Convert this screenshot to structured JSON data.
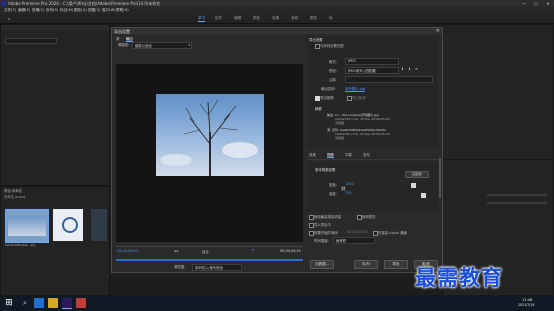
{
  "window": {
    "title": "Adobe Premiere Pro 2020 - C:\\用户\\Ifmy\\文档\\Adobe\\Premiere Pro\\14.0\\未命名",
    "controls": [
      "—",
      "☐",
      "✕"
    ]
  },
  "menubar": [
    "文件(F)",
    "编辑(E)",
    "剪辑(C)",
    "序列(S)",
    "标记(M)",
    "图形(G)",
    "视图(V)",
    "窗口(W)",
    "帮助(H)"
  ],
  "workspaces": {
    "items": [
      "学习",
      "组件",
      "编辑",
      "颜色",
      "效果",
      "音频",
      "图形",
      "库"
    ],
    "active_index": 0
  },
  "project_panel": {
    "title": "项目:未命名",
    "file_label": "未命名.prproj",
    "thumb_label": "5e0af7b8f5ab4e...jpg"
  },
  "dialog": {
    "title": "导出设置",
    "close": "✕",
    "tabs": [
      "源",
      "输出"
    ],
    "active_tab": 1,
    "source_scaling_label": "源缩放:",
    "source_scaling_value": "缩放以适合",
    "timecode_start": "00;00;00;00",
    "timecode_end": "00;00;04;29",
    "fit_label": "适合",
    "source_range_label": "源范围:",
    "source_range_value": "序列切入/序列切出",
    "export_settings": {
      "section_title": "导出设置",
      "match_sequence_label": "与序列设置匹配",
      "format_label": "格式:",
      "format_value": "JPEG",
      "preset_label": "预设:",
      "preset_value": "JPEG序列 (匹配源)",
      "comments_label": "注释:",
      "output_name_label": "输出名称:",
      "output_name_value": "序列图片.jpg",
      "export_video_label": "导出视频",
      "export_audio_label": "导出音频",
      "summary_title": "摘要",
      "summary_output": "输出: C:\\...\\Documents\\序列图片.jpg",
      "summary_output_detail": "1000x750 (1.0), 25 fps, 00;00;05;00",
      "summary_output_note": "无音频",
      "summary_source": "源: 序列, 5e0af7b8f5ab4e2fb56a34bb4c",
      "summary_source_detail": "1000x750 (1.0), 25 fps, 00;00;05;00",
      "summary_source_note": "无音频"
    },
    "settings_tabs": [
      "效果",
      "视频",
      "字幕",
      "发布"
    ],
    "settings_active_tab": 1,
    "basic_video": {
      "title": "基本视频设置",
      "match_source_button": "匹配源",
      "width_label": "宽度:",
      "width_value": "1000",
      "height_label": "高度:",
      "height_value": "750"
    },
    "bottom_checkboxes": [
      "使用最高渲染质量",
      "使用预览",
      "导入项目中",
      "设置开始时间码",
      "仅渲染 Alpha 通道"
    ],
    "start_timecode_value": "00;00;00;00",
    "time_interpolation_label": "时间插值:",
    "time_interpolation_value": "帧采样",
    "buttons": {
      "metadata": "元数据...",
      "queue": "队列",
      "export": "导出",
      "cancel": "取消"
    }
  },
  "taskbar": {
    "time": "11:46",
    "date": "2021/7/19"
  },
  "watermark": "最需教育",
  "colors": {
    "accent": "#6aa8ff",
    "link": "#4d94ff",
    "watermark": "#1a4fd6"
  }
}
